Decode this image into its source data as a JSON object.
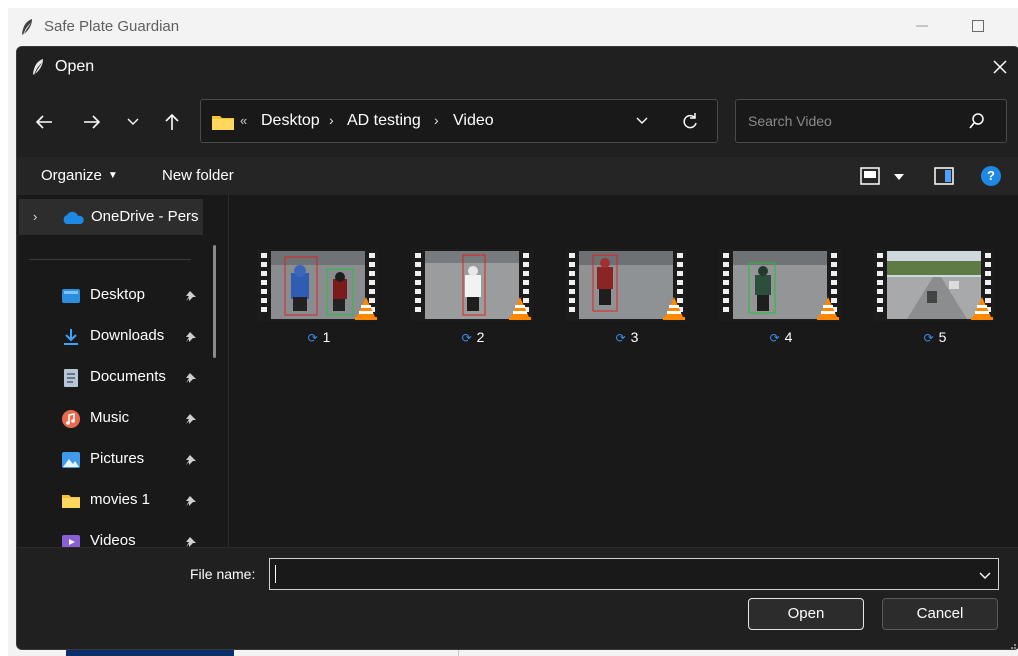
{
  "parent_window": {
    "title": "Safe Plate Guardian"
  },
  "dialog": {
    "title": "Open",
    "address": {
      "overflow": "«",
      "crumbs": [
        "Desktop",
        "AD testing",
        "Video"
      ]
    },
    "search_placeholder": "Search Video",
    "toolbar": {
      "organize_label": "Organize",
      "new_folder_label": "New folder"
    },
    "sidebar": {
      "onedrive_label": "OneDrive - Pers",
      "items": [
        {
          "label": "Desktop",
          "icon": "desktop-icon"
        },
        {
          "label": "Downloads",
          "icon": "download-icon"
        },
        {
          "label": "Documents",
          "icon": "document-icon"
        },
        {
          "label": "Music",
          "icon": "music-icon"
        },
        {
          "label": "Pictures",
          "icon": "pictures-icon"
        },
        {
          "label": "movies 1",
          "icon": "folder-icon"
        },
        {
          "label": "Videos",
          "icon": "videos-icon"
        }
      ]
    },
    "files": [
      {
        "name": "1"
      },
      {
        "name": "2"
      },
      {
        "name": "3"
      },
      {
        "name": "4"
      },
      {
        "name": "5"
      }
    ],
    "bottom": {
      "file_name_label": "File name:",
      "file_name_value": "",
      "open_label": "Open",
      "cancel_label": "Cancel"
    }
  },
  "colors": {
    "dialog_bg": "#191919",
    "bar_bg": "#202020",
    "accent_blue": "#1e88e5",
    "folder_yellow": "#f4c430"
  }
}
